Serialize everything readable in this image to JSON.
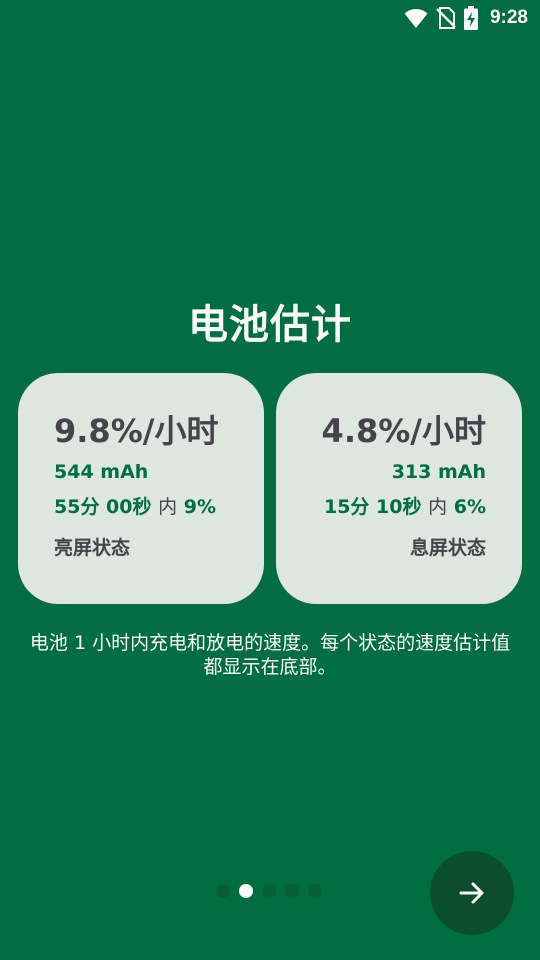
{
  "status_bar": {
    "time": "9:28",
    "icons": [
      "wifi-icon",
      "no-sim-icon",
      "battery-charging-icon"
    ]
  },
  "title": "电池估计",
  "cards": [
    {
      "rate": "9.8%/小时",
      "mah": "544 mAh",
      "duration": "55分 00秒",
      "within": "内",
      "percent": "9%",
      "state": "亮屏状态"
    },
    {
      "rate": "4.8%/小时",
      "mah": "313 mAh",
      "duration": "15分 10秒",
      "within": "内",
      "percent": "6%",
      "state": "息屏状态"
    }
  ],
  "description": "电池 1 小时内充电和放电的速度。每个状态的速度估计值都显示在底部。",
  "pagination": {
    "count": 5,
    "active_index": 1
  },
  "next_button": {
    "icon": "arrow-right-icon"
  },
  "colors": {
    "background": "#006e40",
    "card": "#dde6df",
    "accent": "#006e40",
    "text_dark": "#45444b",
    "fab": "#0b4d2d"
  }
}
